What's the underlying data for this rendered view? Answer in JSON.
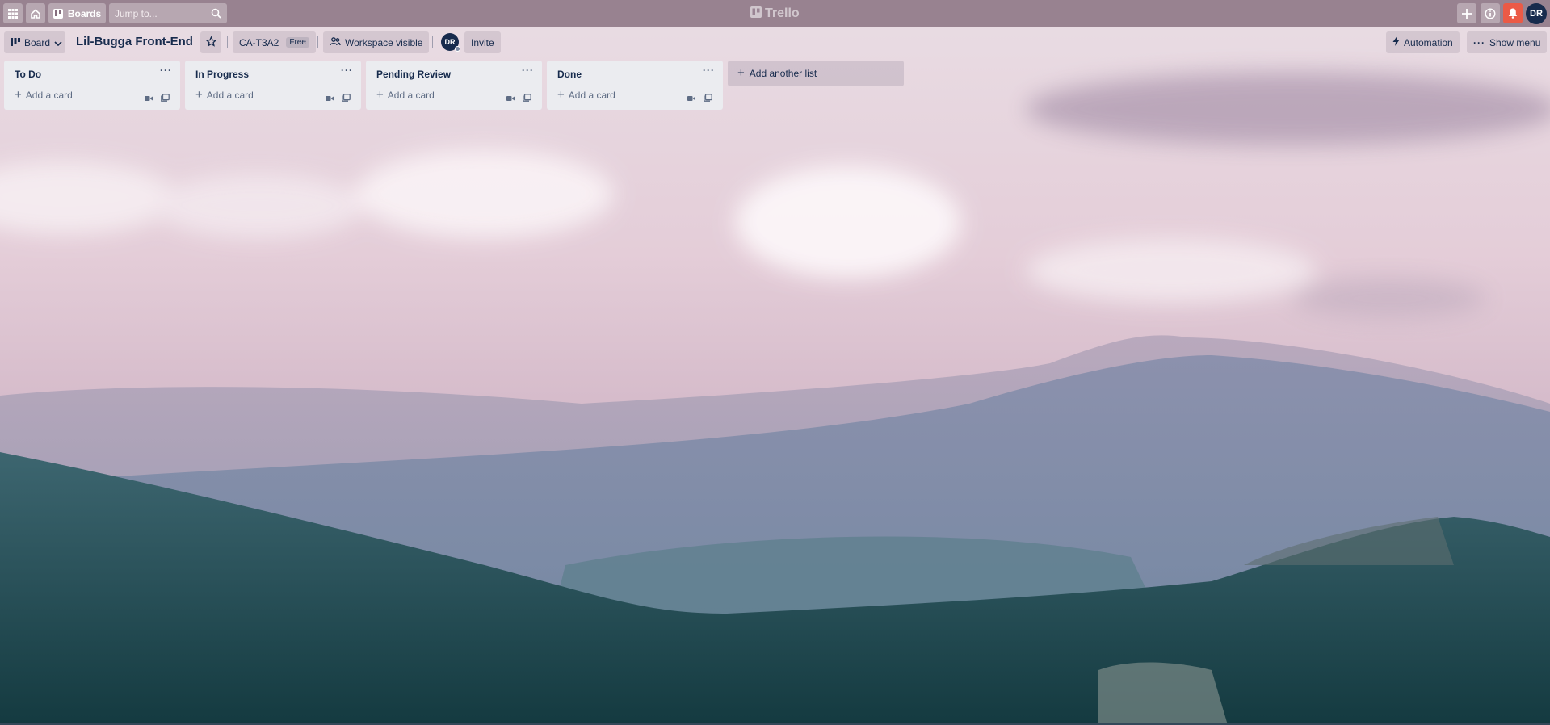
{
  "topbar": {
    "apps_icon": "grid-icon",
    "home_icon": "house-icon",
    "boards_label": "Boards",
    "search_placeholder": "Jump to...",
    "logo_text": "Trello",
    "avatar_initials": "DR",
    "colors": {
      "bar": "#866e7e",
      "notification": "#eb5a46"
    }
  },
  "board": {
    "view_label": "Board",
    "title": "Lil-Bugga Front-End",
    "workspace_name": "CA-T3A2",
    "plan_badge": "Free",
    "visibility_label": "Workspace visible",
    "member_initials": "DR",
    "invite_label": "Invite",
    "automation_label": "Automation",
    "show_menu_label": "Show menu"
  },
  "lists": [
    {
      "title": "To Do",
      "add_card_label": "Add a card"
    },
    {
      "title": "In Progress",
      "add_card_label": "Add a card"
    },
    {
      "title": "Pending Review",
      "add_card_label": "Add a card"
    },
    {
      "title": "Done",
      "add_card_label": "Add a card"
    }
  ],
  "add_list_label": "Add another list",
  "list_menu_glyph": "···"
}
